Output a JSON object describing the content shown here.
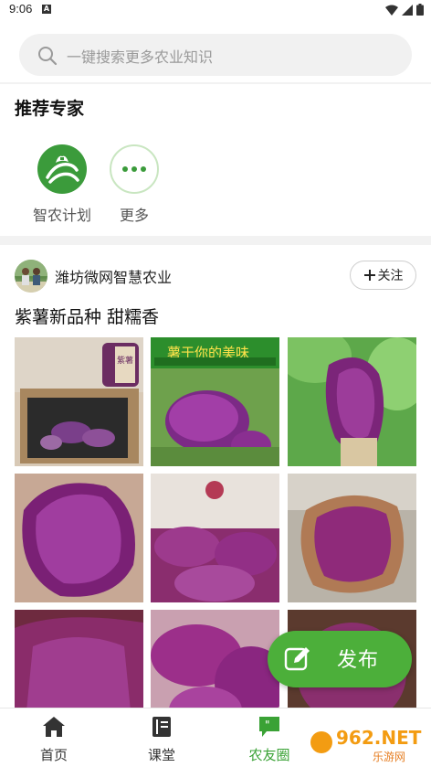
{
  "status_bar": {
    "time": "9:06",
    "notice_letter": "A"
  },
  "search": {
    "placeholder": "一键搜索更多农业知识"
  },
  "experts": {
    "title": "推荐专家",
    "items": [
      {
        "label": "智农计划",
        "icon": "farm-logo-icon"
      },
      {
        "label": "更多",
        "icon": "more-dots-icon"
      }
    ]
  },
  "post": {
    "author": "潍坊微网智慧农业",
    "follow_label": "关注",
    "title": "紫薯新品种 甜糯香",
    "images": [
      {
        "name": "purple-sweet-potato-box",
        "caption": "紫薯"
      },
      {
        "name": "purple-sweet-potato-poster",
        "caption": "薯于你的美味"
      },
      {
        "name": "purple-sweet-potato-leaf"
      },
      {
        "name": "purple-sweet-potato-closeup"
      },
      {
        "name": "purple-sweet-potato-pieces"
      },
      {
        "name": "purple-sweet-potato-peeled"
      },
      {
        "name": "purple-sweet-potato-half"
      },
      {
        "name": "purple-sweet-potato-split"
      },
      {
        "name": "purple-sweet-potato-roasted"
      }
    ]
  },
  "fab": {
    "label": "发布"
  },
  "nav": {
    "items": [
      {
        "label": "首页",
        "active": false
      },
      {
        "label": "课堂",
        "active": false
      },
      {
        "label": "农友圈",
        "active": true
      }
    ]
  },
  "watermark": {
    "text": "962.NET",
    "subtext": "乐游网"
  },
  "colors": {
    "accent": "#3aa235",
    "fab": "#4caf3a",
    "expert_green": "#3b9b3b"
  }
}
